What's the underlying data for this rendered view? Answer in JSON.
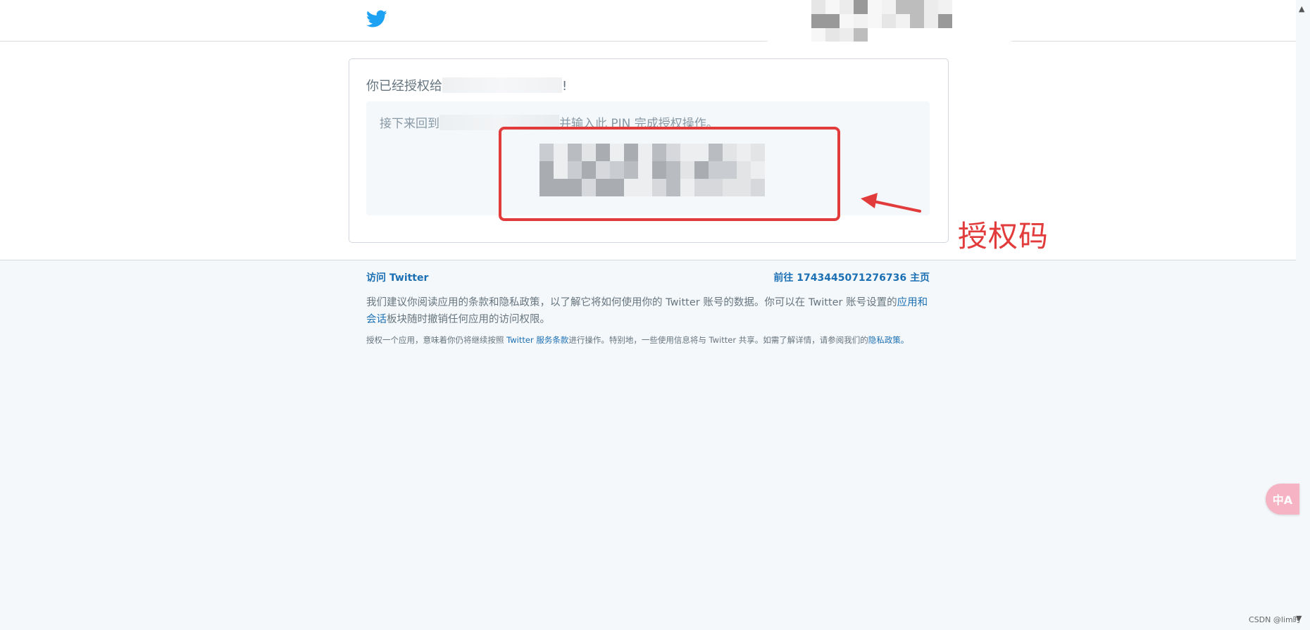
{
  "header": {
    "logo": "twitter-bird-icon"
  },
  "card": {
    "authorized_prefix": "你已经授权给",
    "authorized_suffix": "!",
    "pin_instruction_prefix": "接下来回到",
    "pin_instruction_suffix": "并输入此 PIN 完成授权操作。"
  },
  "annotation": {
    "label": "授权码",
    "color": "#e23b3b"
  },
  "footer": {
    "visit_twitter": "访问 Twitter",
    "goto_home": "前往 1743445071276736 主页",
    "recommend_text": "我们建议你阅读应用的条款和隐私政策，以了解它将如何使用你的 Twitter 账号的数据。你可以在 Twitter 账号设置的",
    "recommend_link": "应用和会话",
    "recommend_tail": "板块随时撤销任何应用的访问权限。",
    "legal_prefix": "授权一个应用，意味着你仍将继续按照 ",
    "legal_link_terms": "Twitter 服务条款",
    "legal_middle": "进行操作。特别地，一些使用信息将与 Twitter 共享。如需了解详情，请参阅我们的",
    "legal_link_privacy": "隐私政策",
    "legal_end": "。"
  },
  "widgets": {
    "translate_label": "中A",
    "watermark": "CSDN @lim时"
  },
  "colors": {
    "twitter_blue": "#1da1f2",
    "link_blue": "#1b6fb3",
    "annotation_red": "#e23b3b"
  }
}
